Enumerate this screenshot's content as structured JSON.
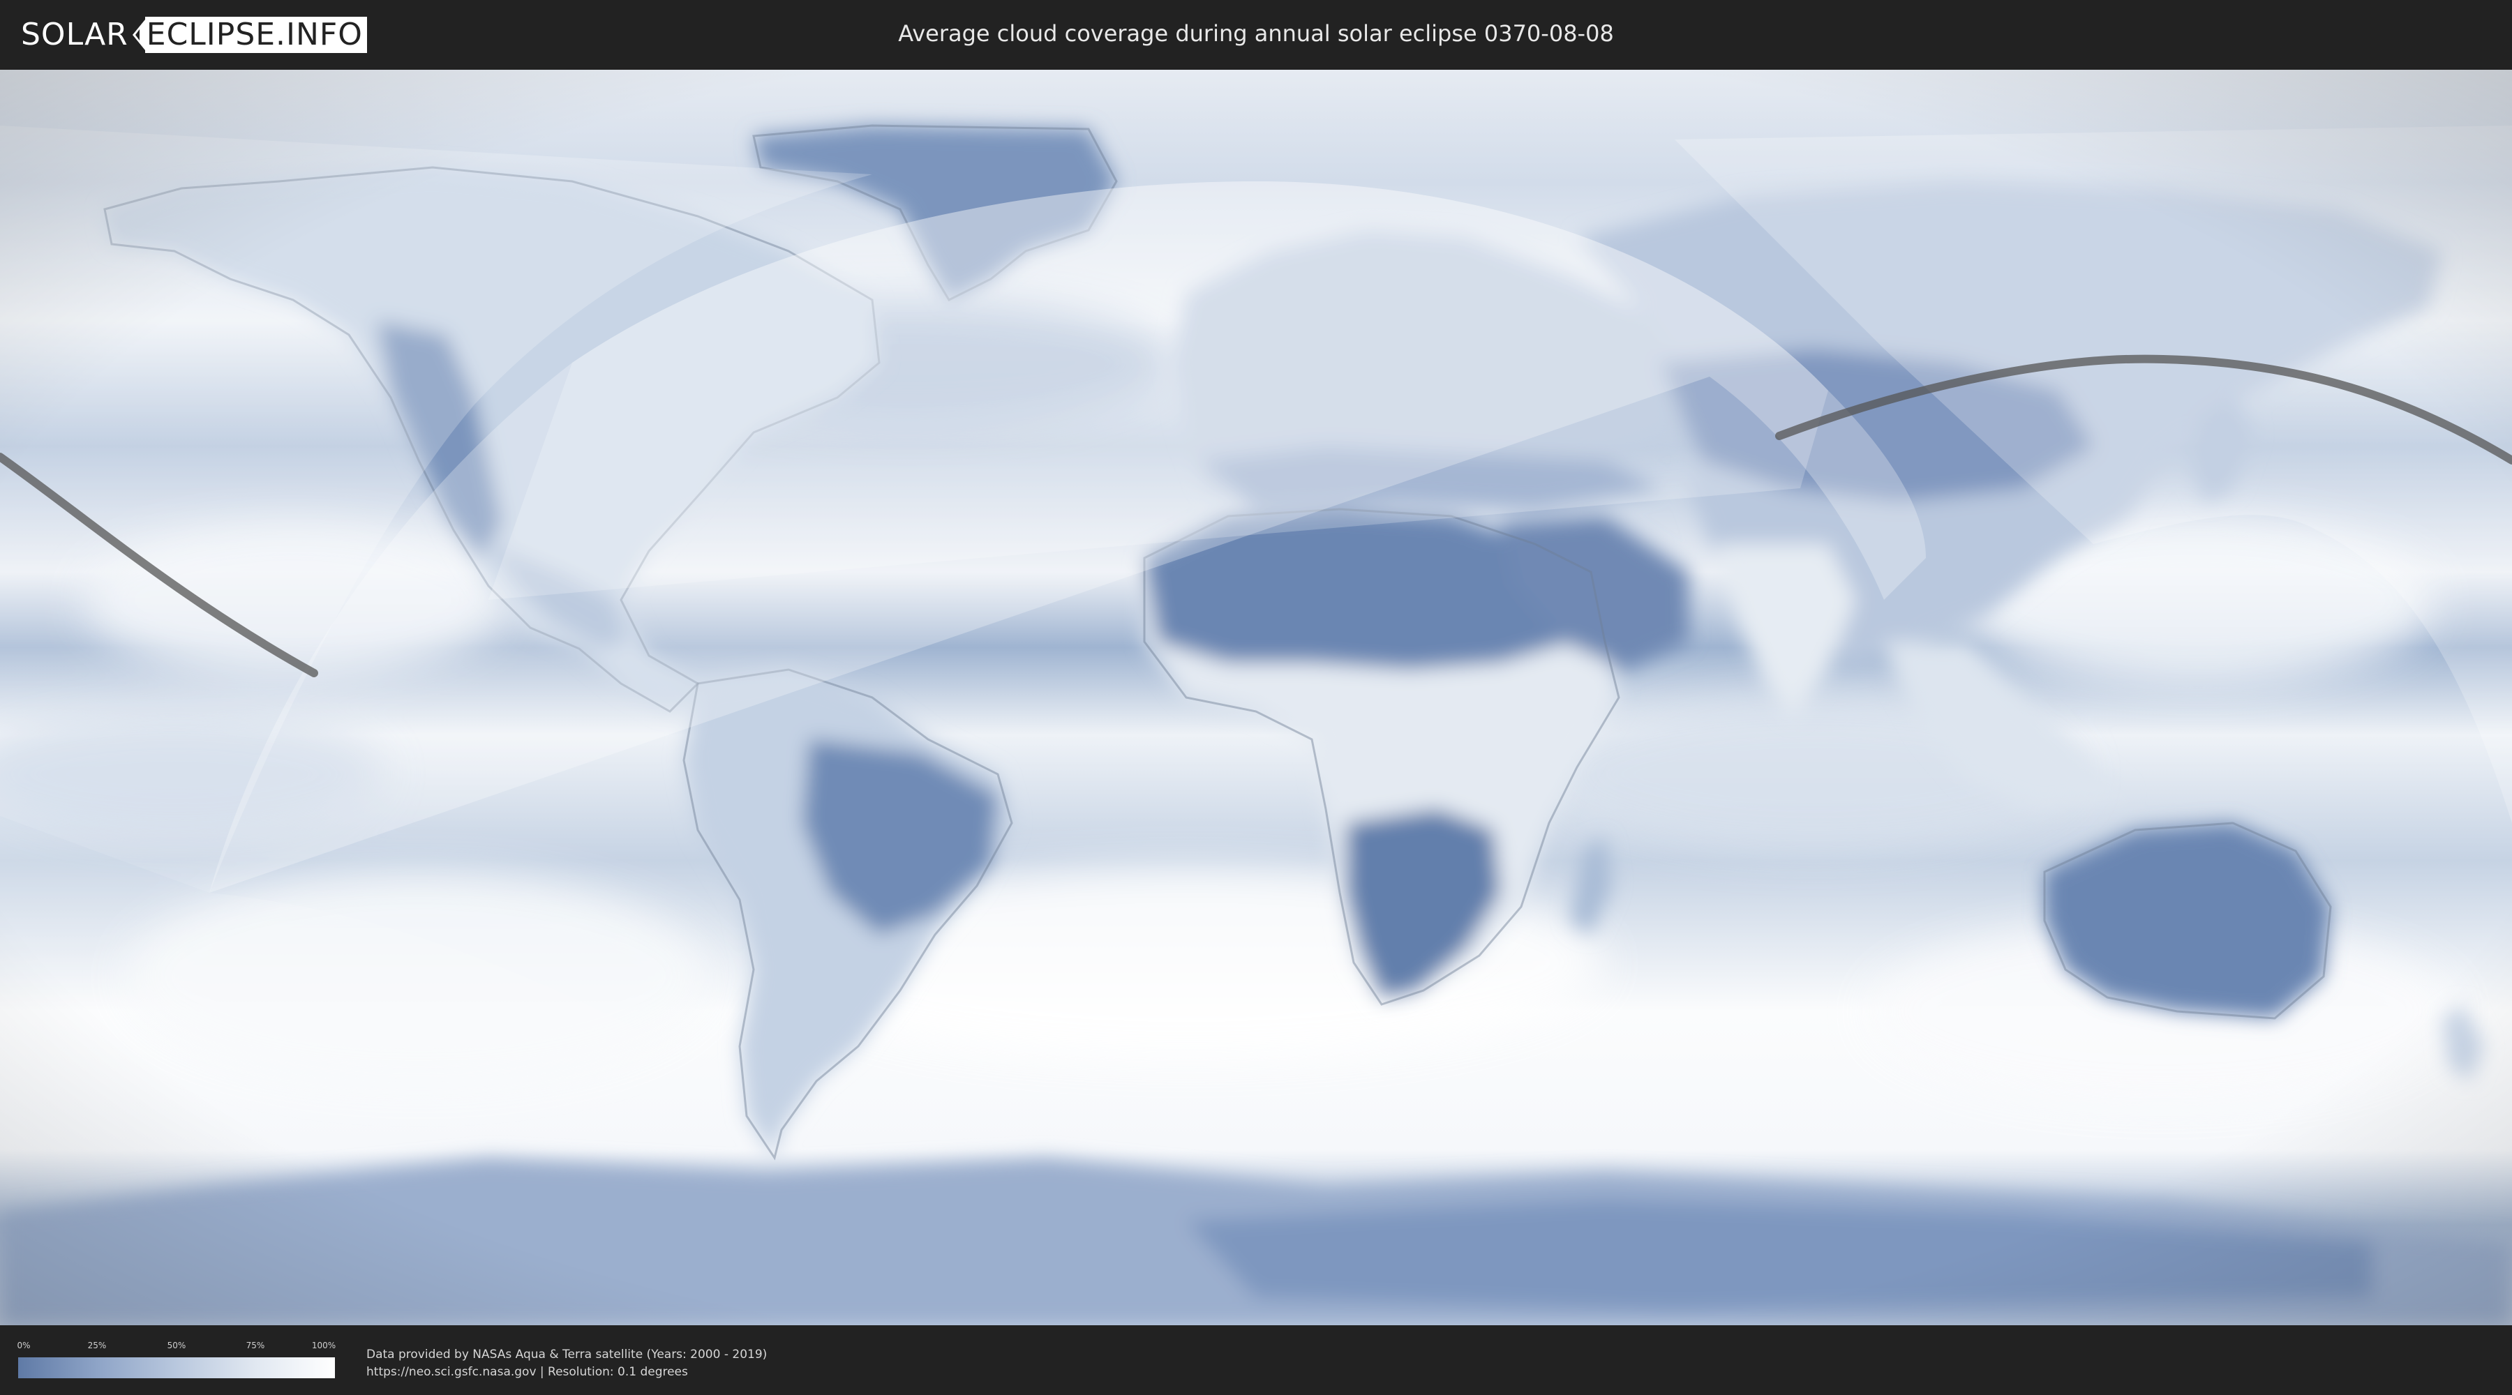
{
  "header": {
    "logo": {
      "part1": "SOLAR",
      "part2": "ECLIPSE.INFO"
    },
    "title": "Average cloud coverage during annual solar eclipse 0370-08-08"
  },
  "map": {
    "projection": "equirectangular",
    "eclipse_path_color": "#555555",
    "visibility_zone": "semi-transparent white overlay",
    "cloud_colors": {
      "clear": "#5f7aa6",
      "overcast": "#ffffff"
    },
    "features": [
      "Greenland",
      "North America",
      "South America",
      "Africa",
      "Europe",
      "Asia",
      "Australia",
      "Antarctica"
    ]
  },
  "legend": {
    "ticks": [
      "0%",
      "25%",
      "50%",
      "75%",
      "100%"
    ],
    "gradient": {
      "start": "#5f7aa6",
      "end": "#ffffff"
    }
  },
  "footer": {
    "line1": "Data provided by NASAs Aqua & Terra satellite (Years: 2000 - 2019)",
    "line2": "https://neo.sci.gsfc.nasa.gov | Resolution: 0.1 degrees"
  }
}
